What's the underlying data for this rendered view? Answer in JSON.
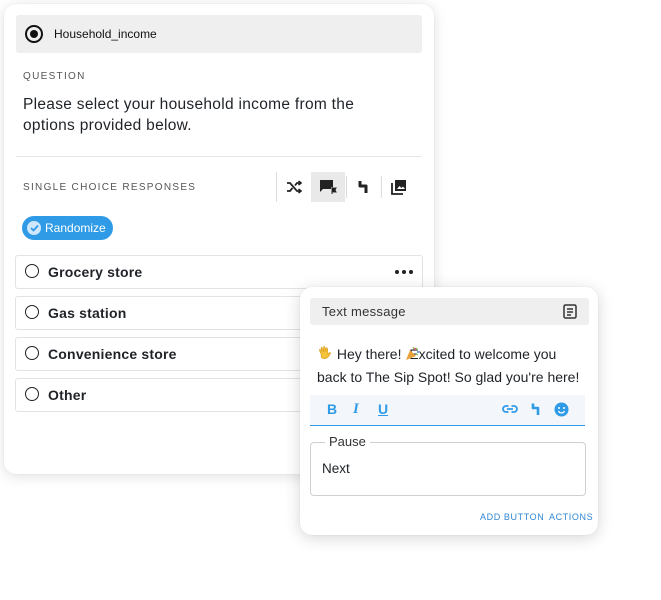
{
  "survey": {
    "question_name": "Household_income",
    "question_section_label": "QUESTION",
    "question_text": "Please select your household income from the options provided below.",
    "responses_section_label": "SINGLE CHOICE RESPONSES",
    "toolbar_icons": [
      "shuffle-icon",
      "comment-flag-icon",
      "branch-icon",
      "image-icon"
    ],
    "randomize_label": "Randomize",
    "options": [
      {
        "label": "Grocery store"
      },
      {
        "label": "Gas station"
      },
      {
        "label": "Convenience store"
      },
      {
        "label": "Other"
      }
    ]
  },
  "message_card": {
    "title": "Text message",
    "body_line1": "Hey there!  Excited to welcome you",
    "body_line2": "back to The Sip Spot! So glad you're here!",
    "format_buttons": [
      "B",
      "I",
      "U"
    ],
    "pause_legend": "Pause",
    "pause_value": "Next",
    "add_button_label": "ADD BUTTON",
    "actions_label": "ACTIONS"
  },
  "colors": {
    "accent": "#2f9be7",
    "header_bg": "#efefef",
    "text": "#1f2328"
  }
}
